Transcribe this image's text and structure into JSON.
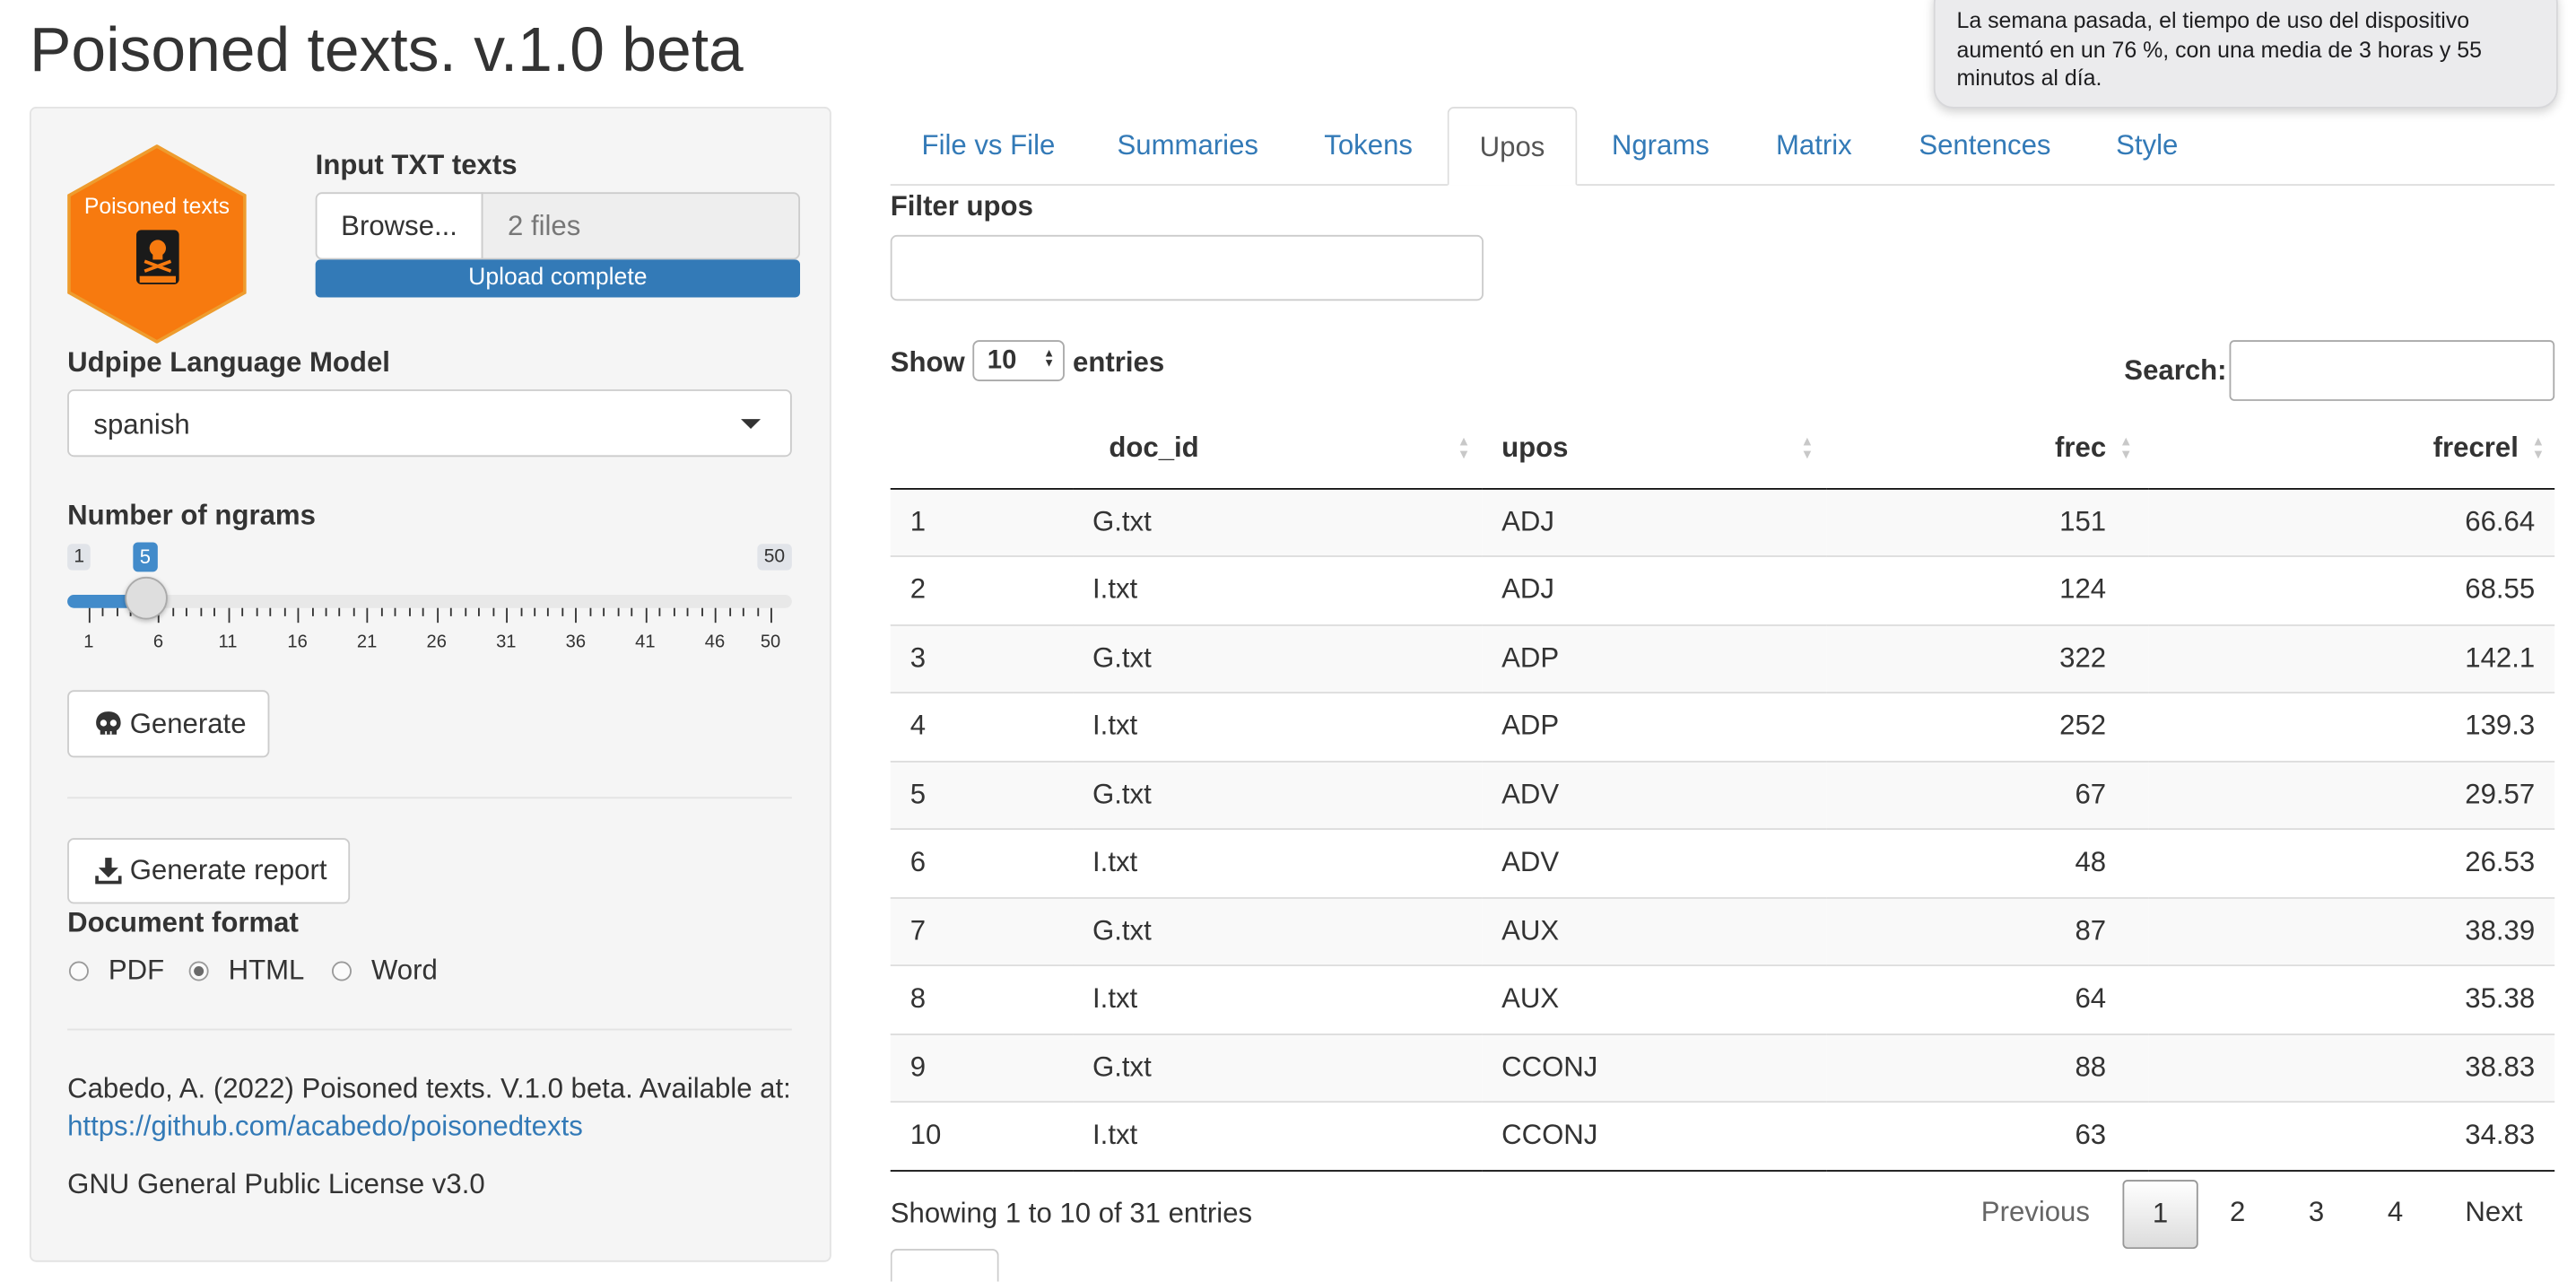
{
  "app": {
    "title": "Poisoned texts. v.1.0 beta"
  },
  "notification": {
    "text": "La semana pasada, el tiempo de uso del dispositivo aumentó en un 76 %, con una media de 3 horas y 55 minutos al día."
  },
  "sidebar": {
    "logo_text": "Poisoned texts",
    "file_input": {
      "label": "Input TXT texts",
      "browse_label": "Browse...",
      "value": "2 files",
      "progress_text": "Upload complete",
      "progress": 1.0
    },
    "model_select": {
      "label": "Udpipe Language Model",
      "value": "spanish"
    },
    "ngram_slider": {
      "label": "Number of ngrams",
      "min": 1,
      "max": 50,
      "value": 5,
      "min_label": "1",
      "max_label": "50",
      "value_label": "5",
      "tick_labels": [
        "1",
        "6",
        "11",
        "16",
        "21",
        "26",
        "31",
        "36",
        "41",
        "46",
        "50"
      ]
    },
    "generate_label": "Generate",
    "report_label": "Generate report",
    "format": {
      "label": "Document format",
      "options": [
        "PDF",
        "HTML",
        "Word"
      ],
      "selected": "HTML"
    },
    "citation": "Cabedo, A. (2022) Poisoned texts. V.1.0 beta. Available at:",
    "link": "https://github.com/acabedo/poisonedtexts",
    "license": "GNU General Public License v3.0"
  },
  "tabs": [
    {
      "label": "File vs File"
    },
    {
      "label": "Summaries"
    },
    {
      "label": "Tokens"
    },
    {
      "label": "Upos",
      "active": true
    },
    {
      "label": "Ngrams"
    },
    {
      "label": "Matrix"
    },
    {
      "label": "Sentences"
    },
    {
      "label": "Style"
    }
  ],
  "filter": {
    "label": "Filter upos",
    "value": ""
  },
  "datatable": {
    "show_label": "Show",
    "length": "10",
    "entries_label": "entries",
    "search_label": "Search:",
    "columns": [
      "",
      "doc_id",
      "upos",
      "frec",
      "frecrel"
    ],
    "rows": [
      [
        "1",
        "G.txt",
        "ADJ",
        "151",
        "66.64"
      ],
      [
        "2",
        "I.txt",
        "ADJ",
        "124",
        "68.55"
      ],
      [
        "3",
        "G.txt",
        "ADP",
        "322",
        "142.1"
      ],
      [
        "4",
        "I.txt",
        "ADP",
        "252",
        "139.3"
      ],
      [
        "5",
        "G.txt",
        "ADV",
        "67",
        "29.57"
      ],
      [
        "6",
        "I.txt",
        "ADV",
        "48",
        "26.53"
      ],
      [
        "7",
        "G.txt",
        "AUX",
        "87",
        "38.39"
      ],
      [
        "8",
        "I.txt",
        "AUX",
        "64",
        "35.38"
      ],
      [
        "9",
        "G.txt",
        "CCONJ",
        "88",
        "38.83"
      ],
      [
        "10",
        "I.txt",
        "CCONJ",
        "63",
        "34.83"
      ]
    ],
    "info": "Showing 1 to 10 of 31 entries",
    "pagination": {
      "previous": "Previous",
      "pages": [
        "1",
        "2",
        "3",
        "4"
      ],
      "current": "1",
      "next": "Next"
    }
  },
  "colors": {
    "accent": "#337ab7",
    "slider": "#428bca",
    "logo": "#f77a0f"
  },
  "icons": {
    "generate": "skull-icon",
    "report": "download-icon",
    "logo": "poison-book-icon"
  }
}
